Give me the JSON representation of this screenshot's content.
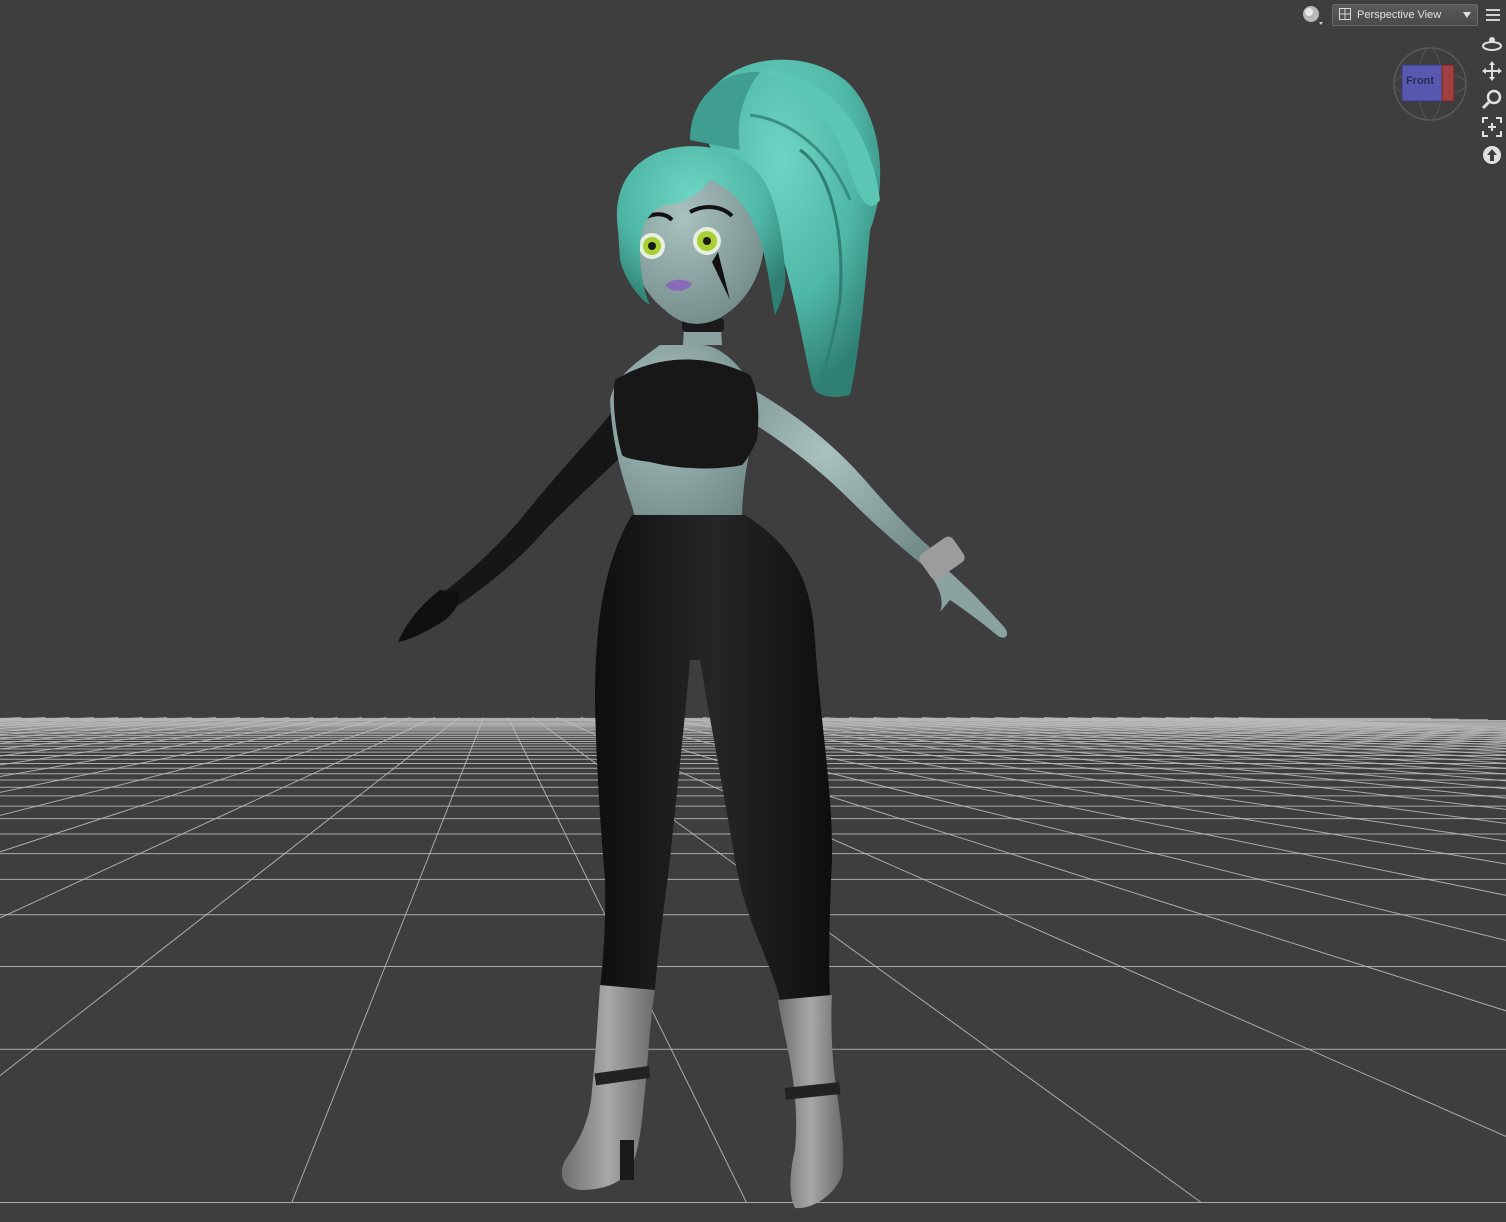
{
  "viewport": {
    "background_color": "#3e3e3e",
    "grid_color": "#bdbdbd"
  },
  "toolbar": {
    "shading_icon": "sphere-shading-icon",
    "view_select": {
      "selected": "Perspective View",
      "icon": "viewport-layout-icon"
    },
    "menu_icon": "viewport-menu-icon"
  },
  "view_cube": {
    "label": "Front",
    "colors": {
      "front": "#5858b0",
      "right": "#a04040"
    }
  },
  "nav_tools": [
    {
      "name": "orbit-icon"
    },
    {
      "name": "pan-icon"
    },
    {
      "name": "zoom-icon"
    },
    {
      "name": "frame-icon"
    },
    {
      "name": "reset-view-icon"
    }
  ],
  "figure": {
    "hair_color": "#4fb7a6",
    "skin_color": "#8fa8a6",
    "clothing_color": "#181818",
    "boot_color": "#8a8a8a",
    "eye_color": "#a8d030",
    "lip_color": "#8a6ab8"
  }
}
